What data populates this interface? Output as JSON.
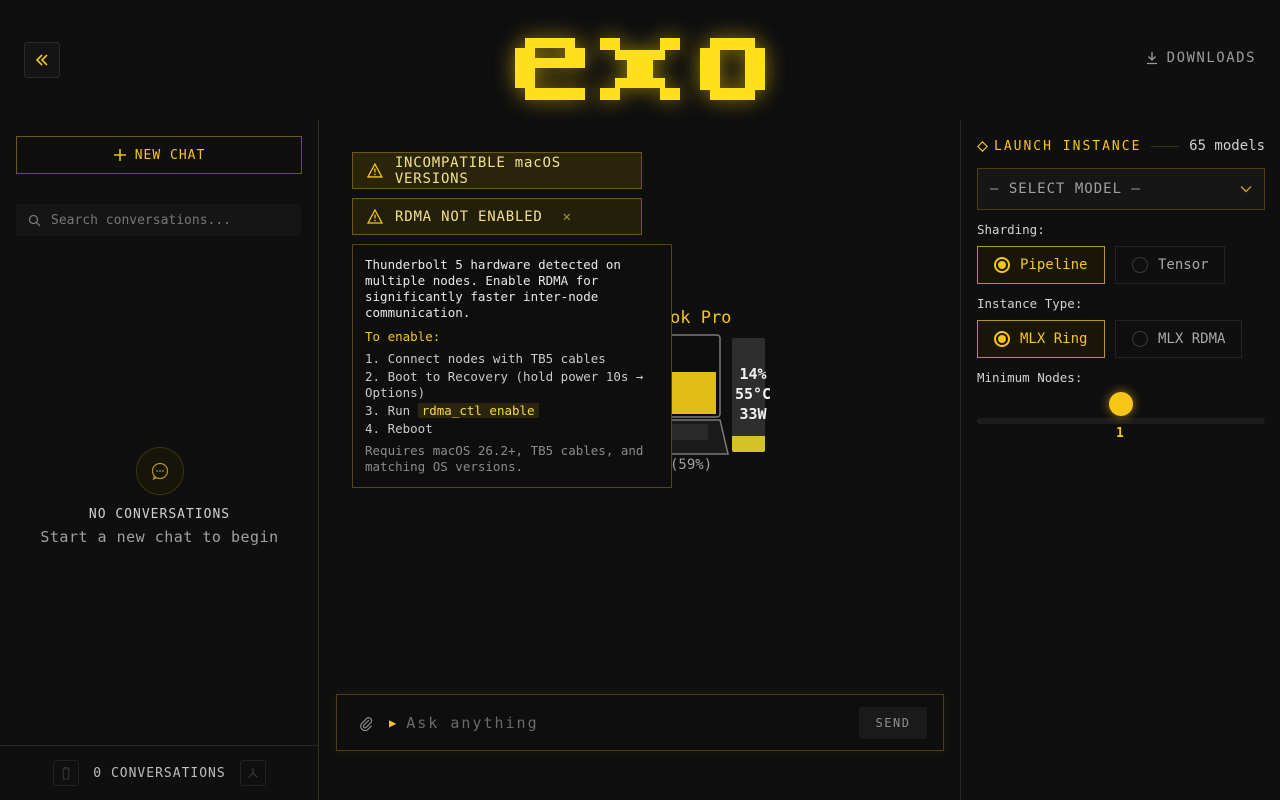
{
  "header": {
    "logo_text": "exo",
    "downloads_label": "DOWNLOADS"
  },
  "sidebar": {
    "new_chat_label": "NEW CHAT",
    "search_placeholder": "Search conversations...",
    "empty_title": "NO CONVERSATIONS",
    "empty_subtitle": "Start a new chat to begin",
    "footer_count": "0 CONVERSATIONS"
  },
  "alerts": [
    {
      "label": "INCOMPATIBLE macOS VERSIONS"
    },
    {
      "label": "RDMA NOT ENABLED"
    }
  ],
  "rdma_popover": {
    "description": "Thunderbolt 5 hardware detected on multiple nodes. Enable RDMA for significantly faster inter-node communication.",
    "enable_heading": "To enable:",
    "step1": "1. Connect nodes with TB5 cables",
    "step2": "2. Boot to Recovery (hold power 10s → Options)",
    "step3_prefix": "3. Run ",
    "step3_code": "rdma_ctl enable",
    "step4": "4. Reboot",
    "requirements": "Requires macOS 26.2+, TB5 cables, and matching OS versions."
  },
  "device": {
    "title_partial": "ok Pro",
    "usage_partial": "(59%)",
    "gpu_usage": "14%",
    "temperature": "55°C",
    "power": "33W",
    "gpu_fill_fraction": 0.14
  },
  "composer": {
    "placeholder": "Ask anything",
    "send_label": "SEND"
  },
  "launch": {
    "title": "LAUNCH INSTANCE",
    "model_count": "65 models",
    "select_placeholder": "— SELECT MODEL —",
    "sharding_label": "Sharding:",
    "sharding_options": [
      "Pipeline",
      "Tensor"
    ],
    "sharding_selected": "Pipeline",
    "instance_label": "Instance Type:",
    "instance_options": [
      "MLX Ring",
      "MLX RDMA"
    ],
    "instance_selected": "MLX Ring",
    "min_nodes_label": "Minimum Nodes:",
    "min_nodes_value": "1"
  },
  "colors": {
    "accent": "#f5c518",
    "background": "#0f0f0f"
  }
}
